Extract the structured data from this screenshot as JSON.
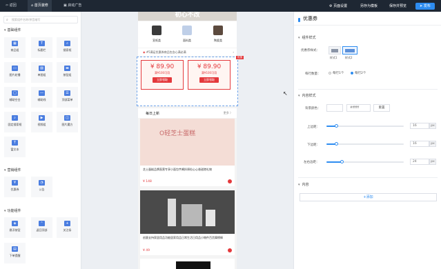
{
  "topbar": {
    "back": "返回",
    "tab_home": "首页装修",
    "tab_ad": "启动广告",
    "page_settings": "页面设置",
    "save_template": "另存为模板",
    "save_preview": "保存并预览",
    "publish": "发布"
  },
  "left": {
    "search_placeholder": "搜索组件名称/拼音缩写",
    "sections": [
      {
        "title": "基础组件",
        "items": [
          "商品组",
          "标题栏",
          "搜索框",
          "图片轮播",
          "单图组",
          "按钮组",
          "辅助空白",
          "辅助线",
          "顶部菜单",
          "固定搜索框",
          "视频组",
          "图片魔方",
          "富文本"
        ]
      },
      {
        "title": "营销组件",
        "items": [
          "优惠券",
          "公告"
        ]
      },
      {
        "title": "功能组件",
        "items": [
          "悬浮按钮",
          "返回顶部",
          "关注条",
          "下单提醒"
        ]
      }
    ]
  },
  "canvas": {
    "banner_text": "初心不改",
    "categories": [
      "宣纸类",
      "面料类",
      "陶瓷类"
    ],
    "notice": "#5满足优惠券商品包含心满必满",
    "coupons": [
      {
        "amount": "¥ 89.90",
        "cond": "满¥100可用",
        "btn": "立即领取"
      },
      {
        "amount": "¥ 89.90",
        "cond": "满¥100可用",
        "btn": "立即领取"
      }
    ],
    "coupon_tag": "优惠",
    "daily_title": "每日上新",
    "daily_more": "更多 〉",
    "cake_text": "O轻芝士蛋糕",
    "products": [
      {
        "name": "芝士蛋糕品牌直营专享小面包芋酱拌原粒心心香甜港礼物",
        "price": "¥ 148"
      },
      {
        "name": "创意支持家居用品功能居家用品日常生活日用品小物件百货摩擦棒",
        "price": "¥ 49"
      }
    ]
  },
  "right": {
    "title": "优惠券",
    "sec_coupon_style": "组件样式",
    "coupon_style_label": "优惠券样式：",
    "style1": "样式1",
    "style2": "样式2",
    "row_count_label": "每行数量：",
    "per_row_1": "每行1个",
    "per_row_2": "每行2个",
    "sec_content_style": "内容样式",
    "bg_color_label": "背景颜色：",
    "bg_color_value": "#ffffff",
    "reset": "重置",
    "top_margin_label": "上边距：",
    "top_margin_value": "16",
    "bottom_margin_label": "下边距：",
    "bottom_margin_value": "16",
    "side_margin_label": "左右边距：",
    "side_margin_value": "24",
    "unit": "px",
    "sec_content": "内容",
    "add_btn": "+添加"
  },
  "colors": {
    "accent": "#2d8cf0",
    "coupon_red": "#e4393c",
    "dark_bar": "#1e2733"
  }
}
